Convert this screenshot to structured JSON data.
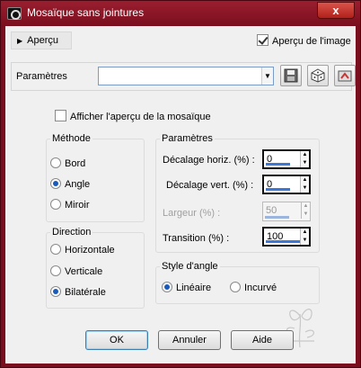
{
  "window": {
    "title": "Mosaïque sans jointures",
    "close_label": "x"
  },
  "preview": {
    "toggle_label": "Aperçu",
    "image_preview_label": "Aperçu de l'image",
    "image_preview_checked": true
  },
  "params": {
    "label": "Paramètres",
    "preset_value": ""
  },
  "tile_preview": {
    "label": "Afficher l'aperçu de la mosaïque",
    "checked": false
  },
  "method": {
    "title": "Méthode",
    "options": [
      "Bord",
      "Angle",
      "Miroir"
    ],
    "selected": "Angle"
  },
  "direction": {
    "title": "Direction",
    "options": [
      "Horizontale",
      "Verticale",
      "Bilatérale"
    ],
    "selected": "Bilatérale"
  },
  "settings": {
    "title": "Paramètres",
    "h_offset_label": "Décalage horiz. (%) :",
    "h_offset_value": "0",
    "v_offset_label": "Décalage vert. (%) :",
    "v_offset_value": "0",
    "width_label": "Largeur (%) :",
    "width_value": "50",
    "transition_label": "Transition (%) :",
    "transition_value": "100"
  },
  "corner_style": {
    "title": "Style d'angle",
    "options": [
      "Linéaire",
      "Incurvé"
    ],
    "selected": "Linéaire"
  },
  "buttons": {
    "ok": "OK",
    "cancel": "Annuler",
    "help": "Aide"
  },
  "colors": {
    "title_bar": "#7a0e1e",
    "accent": "#3b78d8"
  }
}
